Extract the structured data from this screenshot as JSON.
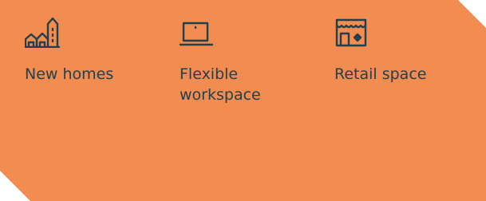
{
  "features": [
    {
      "icon": "homes-buildings-icon",
      "label": "New homes"
    },
    {
      "icon": "laptop-icon",
      "label": "Flexible workspace"
    },
    {
      "icon": "storefront-icon",
      "label": "Retail space"
    }
  ],
  "colors": {
    "panel": "#f28c50",
    "text": "#22404b"
  }
}
